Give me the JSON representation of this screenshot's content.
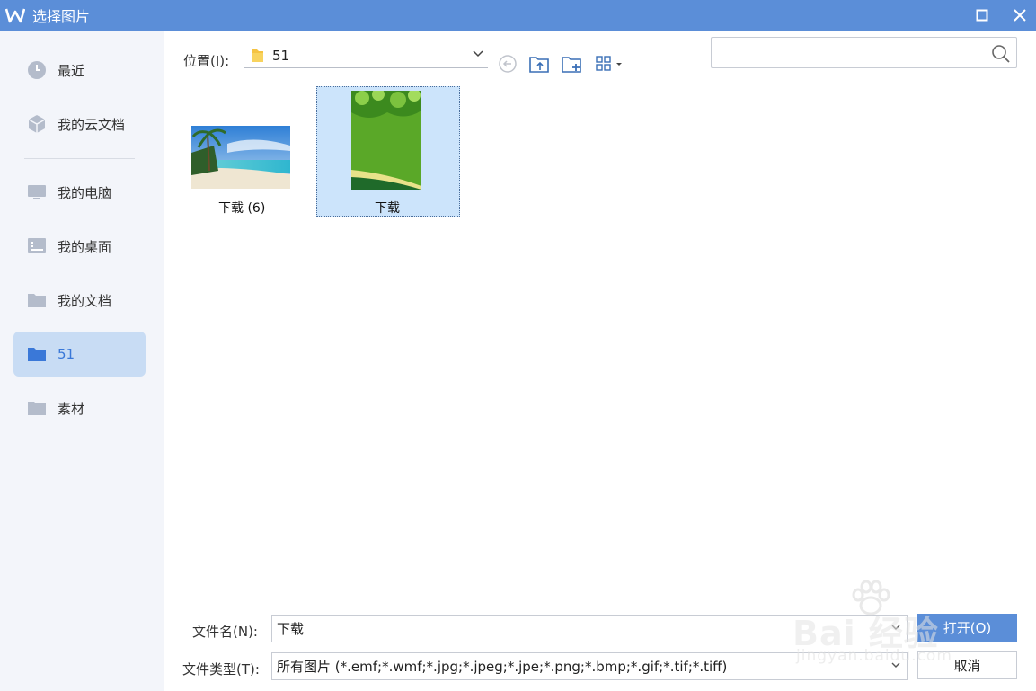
{
  "window": {
    "title": "选择图片"
  },
  "sidebar": {
    "items": [
      {
        "label": "最近",
        "icon": "clock-icon"
      },
      {
        "label": "我的云文档",
        "icon": "cloud-box-icon"
      },
      {
        "label": "我的电脑",
        "icon": "computer-icon"
      },
      {
        "label": "我的桌面",
        "icon": "desktop-icon"
      },
      {
        "label": "我的文档",
        "icon": "folder-icon"
      },
      {
        "label": "51",
        "icon": "folder-icon",
        "active": true
      },
      {
        "label": "素材",
        "icon": "folder-icon"
      }
    ]
  },
  "toolbar": {
    "location_label": "位置(I):",
    "location_value": "51",
    "view_icon": "grid-view-icon"
  },
  "search": {
    "placeholder": ""
  },
  "files": [
    {
      "name": "下载 (6)",
      "thumbnail": "beach-photo"
    },
    {
      "name": "下载",
      "thumbnail": "green-leaves-poster",
      "selected": true
    }
  ],
  "bottom": {
    "filename_label": "文件名(N):",
    "filename_value": "下载",
    "filetype_label": "文件类型(T):",
    "filetype_value": "所有图片 (*.emf;*.wmf;*.jpg;*.jpeg;*.jpe;*.png;*.bmp;*.gif;*.tif;*.tiff)",
    "open_label": "打开(O)",
    "cancel_label": "取消"
  },
  "watermark": {
    "text": "Bai 经验",
    "sub": "jingyan.baidu.com"
  },
  "colors": {
    "accent": "#5b8ed8",
    "sidebar_bg": "#f3f5fa",
    "selected_bg": "#cce4fb",
    "active_sidebar_bg": "#c8dcf4"
  }
}
